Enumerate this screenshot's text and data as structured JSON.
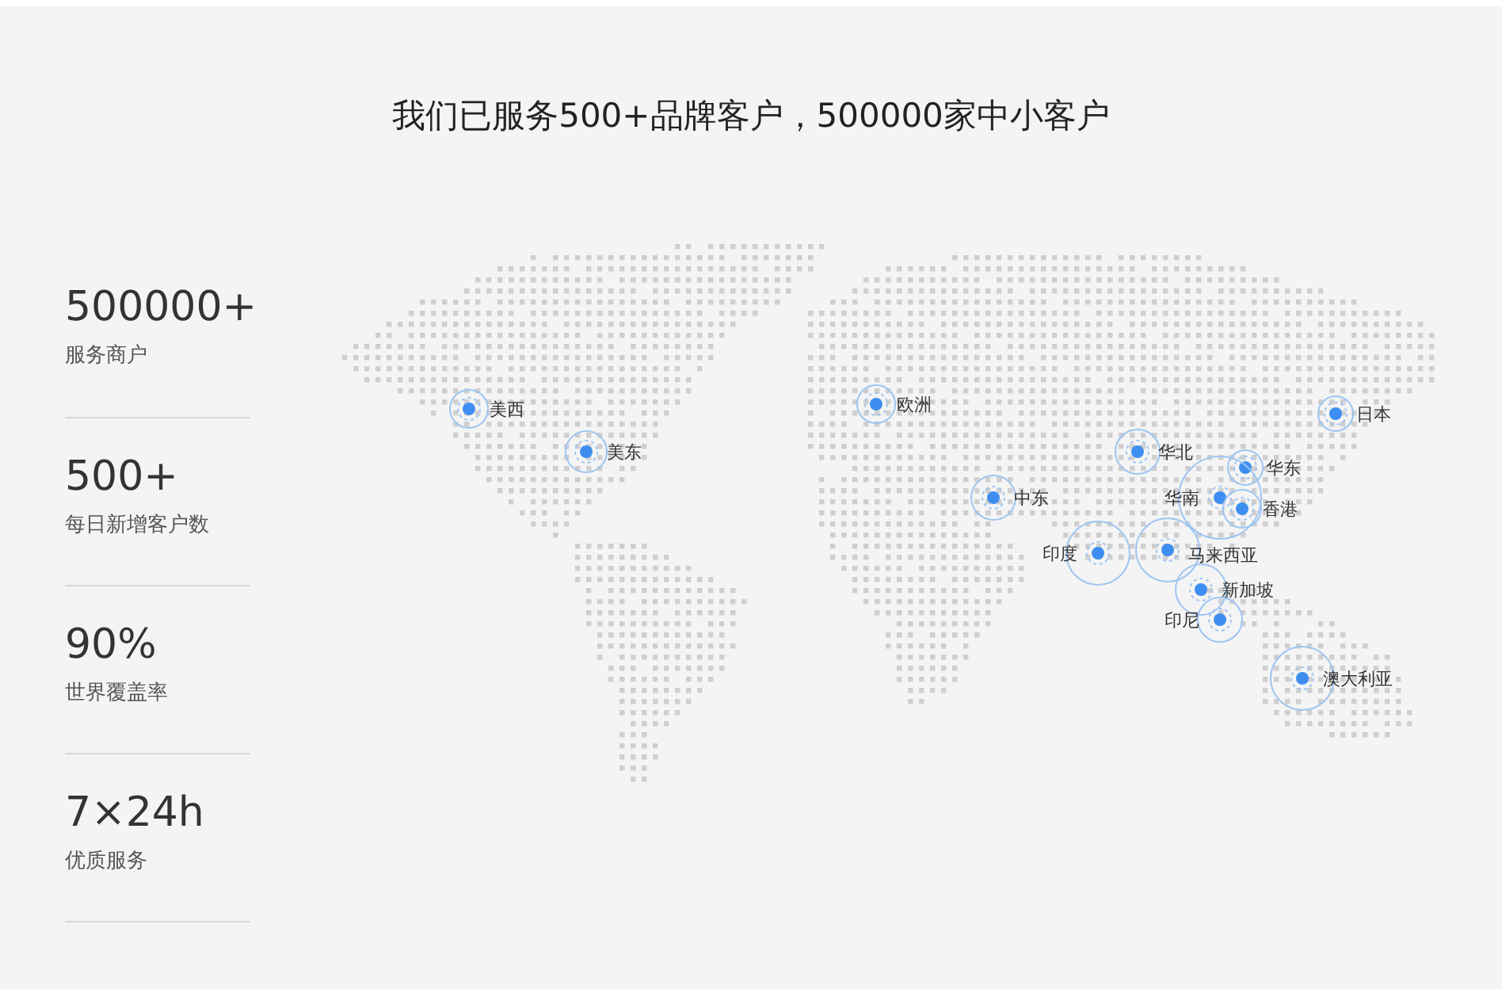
{
  "heading": "我们已服务500+品牌客户，500000家中小客户",
  "stats": [
    {
      "value": "500000+",
      "label": "服务商户"
    },
    {
      "value": "500+",
      "label": "每日新增客户数"
    },
    {
      "value": "90%",
      "label": "世界覆盖率"
    },
    {
      "value": "7×24h",
      "label": "优质服务"
    }
  ],
  "locations": [
    {
      "name": "美西"
    },
    {
      "name": "美东"
    },
    {
      "name": "欧洲"
    },
    {
      "name": "中东"
    },
    {
      "name": "华北"
    },
    {
      "name": "华东"
    },
    {
      "name": "华南"
    },
    {
      "name": "香港"
    },
    {
      "name": "印度"
    },
    {
      "name": "马来西亚"
    },
    {
      "name": "新加坡"
    },
    {
      "name": "印尼"
    },
    {
      "name": "日本"
    },
    {
      "name": "澳大利亚"
    }
  ]
}
